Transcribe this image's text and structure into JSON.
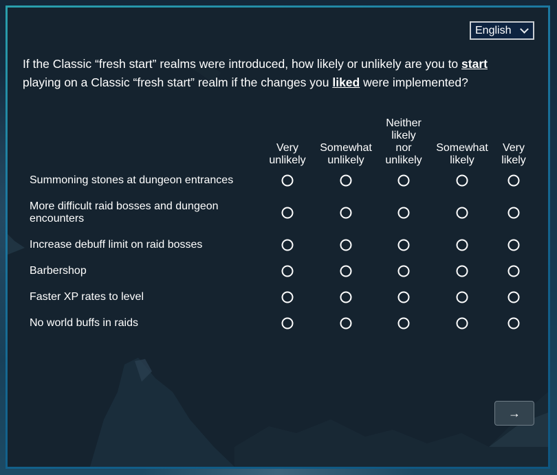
{
  "language_select": {
    "selected": "English",
    "icon": "chevron-down-icon"
  },
  "question": {
    "part1": "If the Classic “fresh start” realms were introduced, how likely or unlikely are you to ",
    "emphasis1": "start",
    "part2": " playing on a Classic “fresh start” realm if the changes you ",
    "emphasis2": "liked",
    "part3": " were implemented?"
  },
  "scale": [
    {
      "label": "Very\nunlikely"
    },
    {
      "label": "Somewhat\nunlikely"
    },
    {
      "label": "Neither\nlikely\nnor\nunlikely"
    },
    {
      "label": "Somewhat\nlikely"
    },
    {
      "label": "Very\nlikely"
    }
  ],
  "rows": [
    {
      "label": "Summoning stones at dungeon entrances",
      "selected": null
    },
    {
      "label": "More difficult raid bosses and dungeon encounters",
      "selected": null
    },
    {
      "label": "Increase debuff limit on raid bosses",
      "selected": null
    },
    {
      "label": "Barbershop",
      "selected": null
    },
    {
      "label": "Faster XP rates to level",
      "selected": null
    },
    {
      "label": "No world buffs in raids",
      "selected": null
    }
  ],
  "next_button": {
    "label": "→",
    "icon": "arrow-right-icon"
  },
  "colors": {
    "panel_bg": "#15232f",
    "border_teal": "#2aa0ad",
    "border_blue": "#0f5680",
    "select_bg": "#0d2340",
    "button_bg": "#33434e",
    "text": "#ffffff"
  }
}
